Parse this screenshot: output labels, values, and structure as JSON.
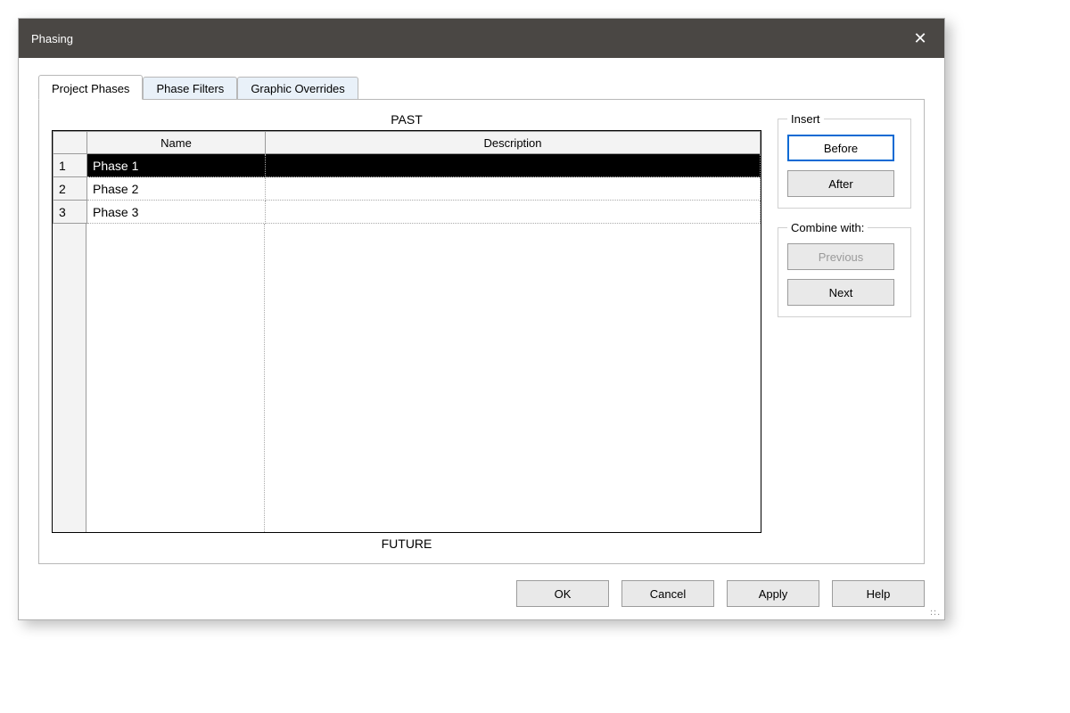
{
  "dialog": {
    "title": "Phasing"
  },
  "tabs": [
    {
      "label": "Project Phases",
      "active": true
    },
    {
      "label": "Phase Filters",
      "active": false
    },
    {
      "label": "Graphic Overrides",
      "active": false
    }
  ],
  "labels": {
    "past": "PAST",
    "future": "FUTURE"
  },
  "columns": {
    "name": "Name",
    "description": "Description"
  },
  "rows": [
    {
      "num": "1",
      "name": "Phase 1",
      "description": "",
      "selected": true
    },
    {
      "num": "2",
      "name": "Phase 2",
      "description": "",
      "selected": false
    },
    {
      "num": "3",
      "name": "Phase 3",
      "description": "",
      "selected": false
    }
  ],
  "groups": {
    "insert_legend": "Insert",
    "combine_legend": "Combine with:"
  },
  "buttons": {
    "before": "Before",
    "after": "After",
    "previous": "Previous",
    "next": "Next",
    "ok": "OK",
    "cancel": "Cancel",
    "apply": "Apply",
    "help": "Help"
  }
}
